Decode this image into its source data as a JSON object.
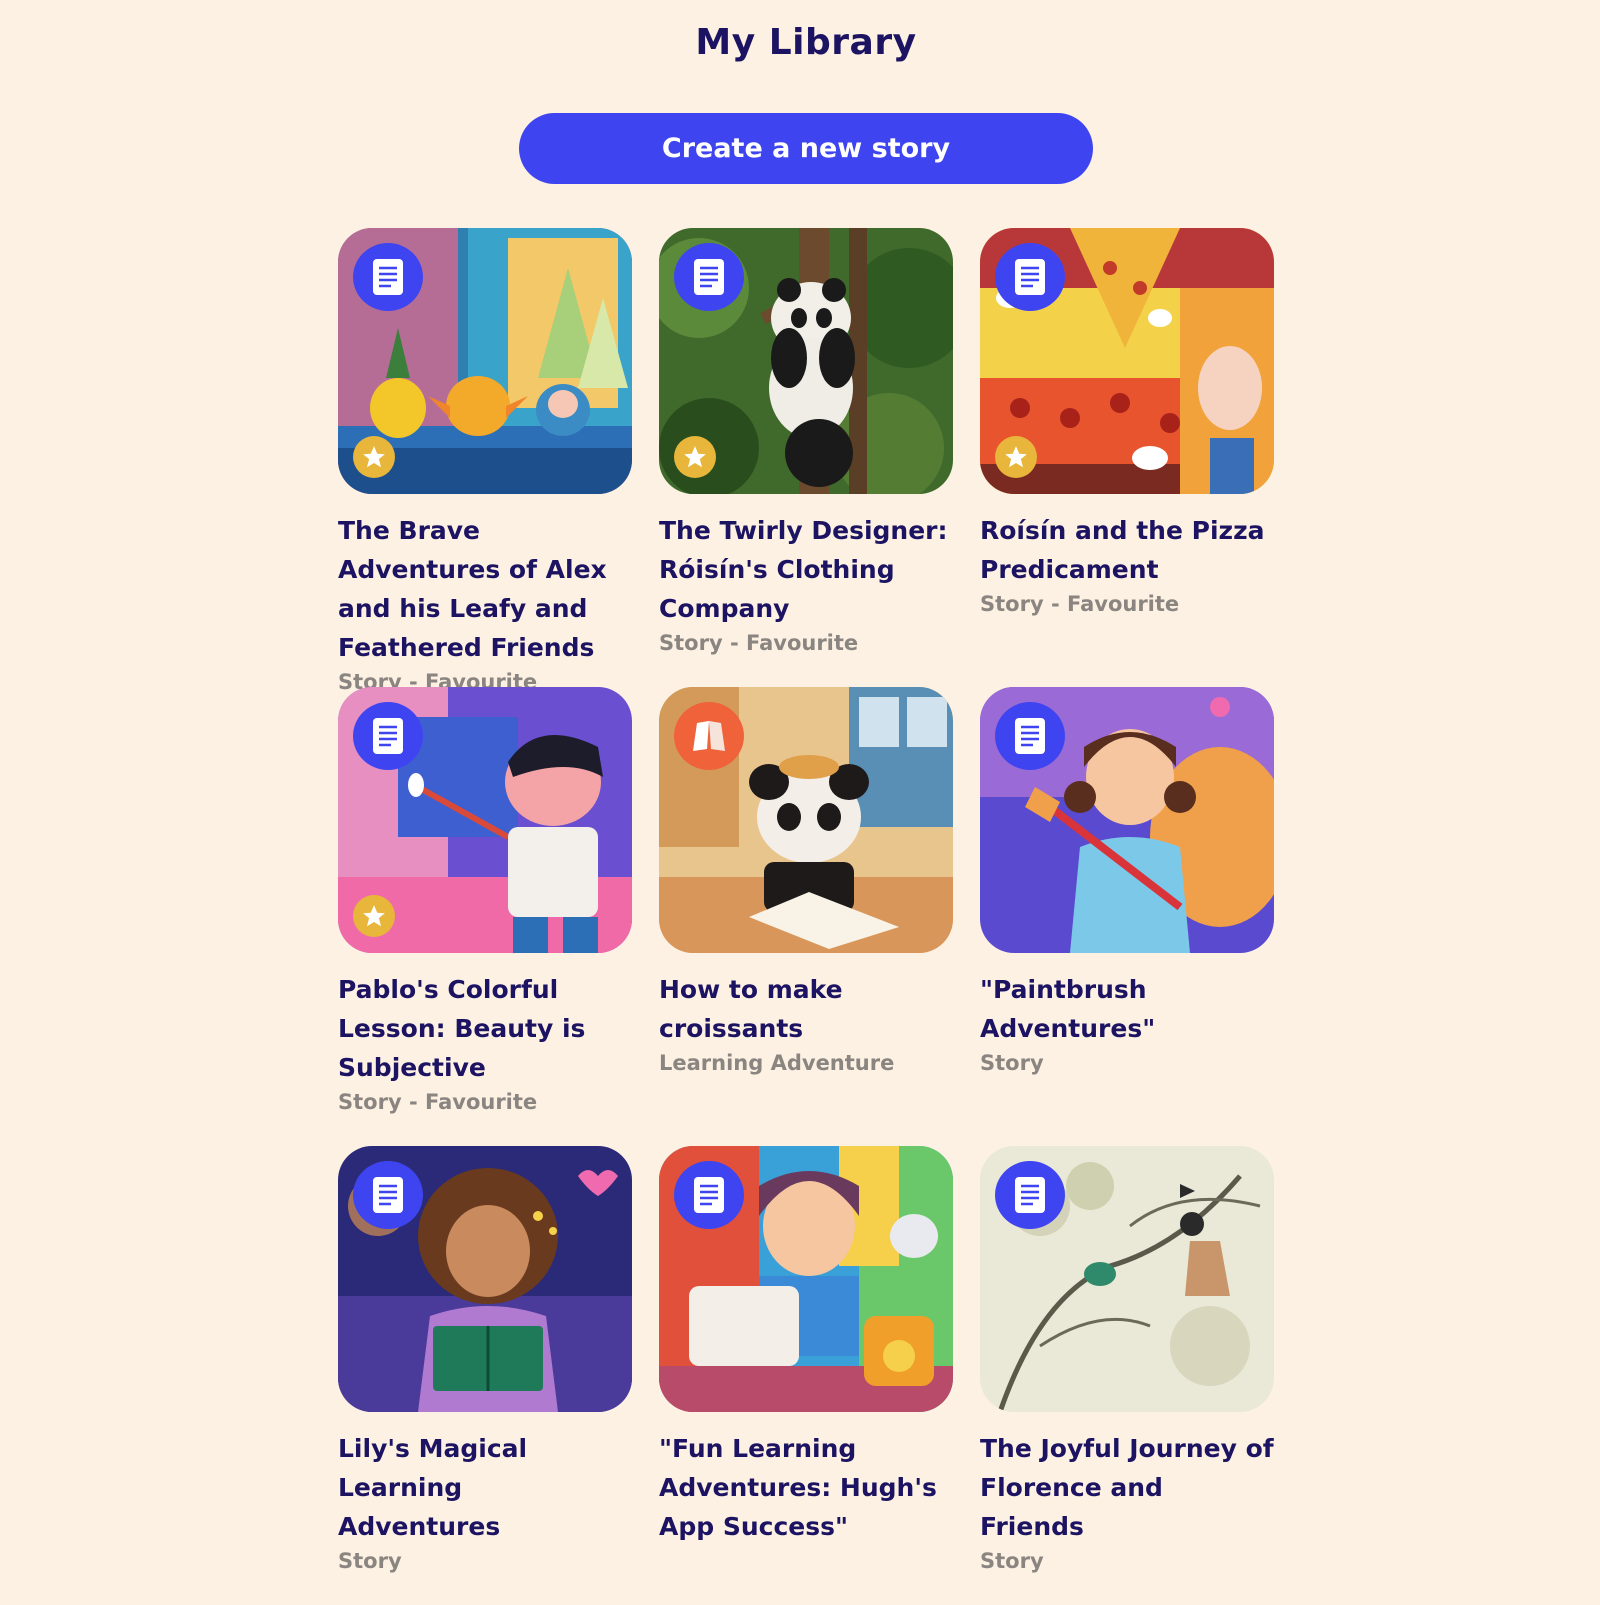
{
  "page": {
    "title": "My Library",
    "create_label": "Create a new story"
  },
  "colors": {
    "background": "#fcf1e2",
    "accent": "#3e45f0",
    "title_text": "#1c1462",
    "meta_text": "#8a8580",
    "favourite_badge": "#e8b63a",
    "lesson_badge": "#f0623a"
  },
  "cards": [
    {
      "title": "The Brave Adventures of Alex and his Leafy and Feathered Friends",
      "meta": "Story - Favourite",
      "type_icon": "document-icon",
      "favourite": true
    },
    {
      "title": "The Twirly Designer: Róisín's Clothing Company",
      "meta": "Story - Favourite",
      "type_icon": "document-icon",
      "favourite": true
    },
    {
      "title": "Roísín and the Pizza Predicament",
      "meta": "Story - Favourite",
      "type_icon": "document-icon",
      "favourite": true
    },
    {
      "title": "Pablo's Colorful Lesson: Beauty is Subjective",
      "meta": "Story - Favourite",
      "type_icon": "document-icon",
      "favourite": true
    },
    {
      "title": "How to make croissants",
      "meta": "Learning Adventure",
      "type_icon": "book-icon",
      "favourite": false
    },
    {
      "title": "\"Paintbrush Adventures\"",
      "meta": "Story",
      "type_icon": "document-icon",
      "favourite": false
    },
    {
      "title": "Lily's Magical Learning Adventures",
      "meta": "Story",
      "type_icon": "document-icon",
      "favourite": false
    },
    {
      "title": "\"Fun Learning Adventures: Hugh's App Success\"",
      "meta": "",
      "type_icon": "document-icon",
      "favourite": false
    },
    {
      "title": "The Joyful Journey of Florence and Friends",
      "meta": "Story",
      "type_icon": "document-icon",
      "favourite": false
    }
  ]
}
